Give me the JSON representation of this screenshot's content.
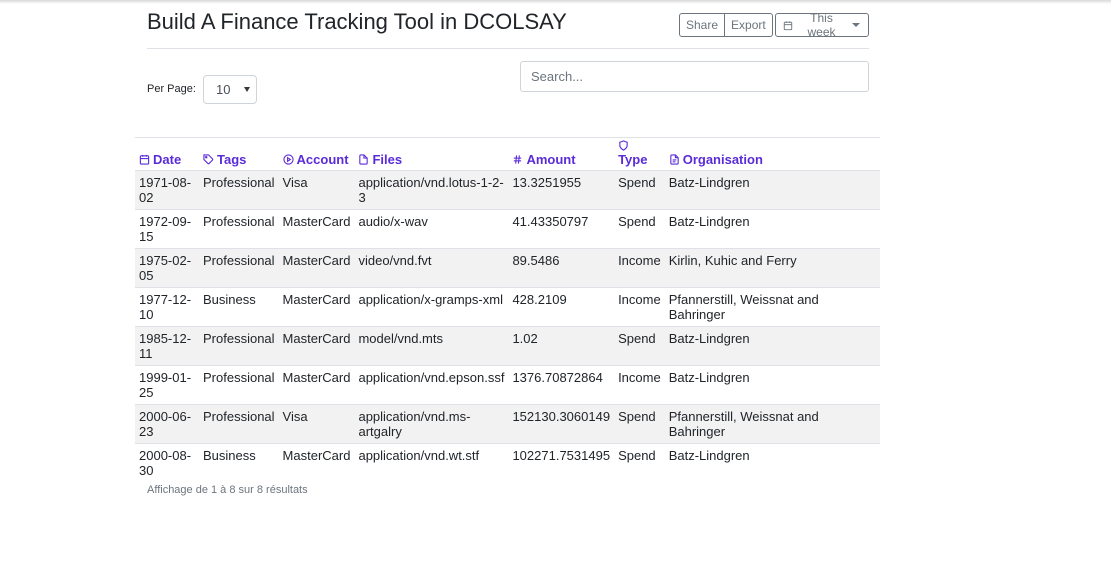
{
  "page": {
    "title": "Build A Finance Tracking Tool in DCOLSAY"
  },
  "toolbar": {
    "share_label": "Share",
    "export_label": "Export",
    "period_label": "This week"
  },
  "controls": {
    "per_page_label": "Per Page:",
    "per_page_value": "10",
    "search_placeholder": "Search...",
    "search_value": ""
  },
  "table": {
    "columns": [
      {
        "label": "Date",
        "icon": "calendar-icon"
      },
      {
        "label": "Tags",
        "icon": "tag-icon"
      },
      {
        "label": "Account",
        "icon": "play-circle-icon"
      },
      {
        "label": "Files",
        "icon": "file-icon"
      },
      {
        "label": "Amount",
        "icon": "hash-icon"
      },
      {
        "label": "Type",
        "icon": "shield-icon"
      },
      {
        "label": "Organisation",
        "icon": "document-icon"
      }
    ],
    "rows": [
      [
        "1971-08-02",
        "Professional",
        "Visa",
        "application/vnd.lotus-1-2-3",
        "13.3251955",
        "Spend",
        "Batz-Lindgren"
      ],
      [
        "1972-09-15",
        "Professional",
        "MasterCard",
        "audio/x-wav",
        "41.43350797",
        "Spend",
        "Batz-Lindgren"
      ],
      [
        "1975-02-05",
        "Professional",
        "MasterCard",
        "video/vnd.fvt",
        "89.5486",
        "Income",
        "Kirlin, Kuhic and Ferry"
      ],
      [
        "1977-12-10",
        "Business",
        "MasterCard",
        "application/x-gramps-xml",
        "428.2109",
        "Income",
        "Pfannerstill, Weissnat and Bahringer"
      ],
      [
        "1985-12-11",
        "Professional",
        "MasterCard",
        "model/vnd.mts",
        "1.02",
        "Spend",
        "Batz-Lindgren"
      ],
      [
        "1999-01-25",
        "Professional",
        "MasterCard",
        "application/vnd.epson.ssf",
        "1376.70872864",
        "Income",
        "Batz-Lindgren"
      ],
      [
        "2000-06-23",
        "Professional",
        "Visa",
        "application/vnd.ms-artgalry",
        "152130.3060149",
        "Spend",
        "Pfannerstill, Weissnat and Bahringer"
      ],
      [
        "2000-08-30",
        "Business",
        "MasterCard",
        "application/vnd.wt.stf",
        "102271.7531495",
        "Spend",
        "Batz-Lindgren"
      ]
    ]
  },
  "footer": {
    "info": "Affichage de 1 à 8 sur 8 résultats"
  },
  "colors": {
    "accent": "#5a2bd8",
    "stripe": "#f2f2f2",
    "border": "#dee2e6"
  }
}
